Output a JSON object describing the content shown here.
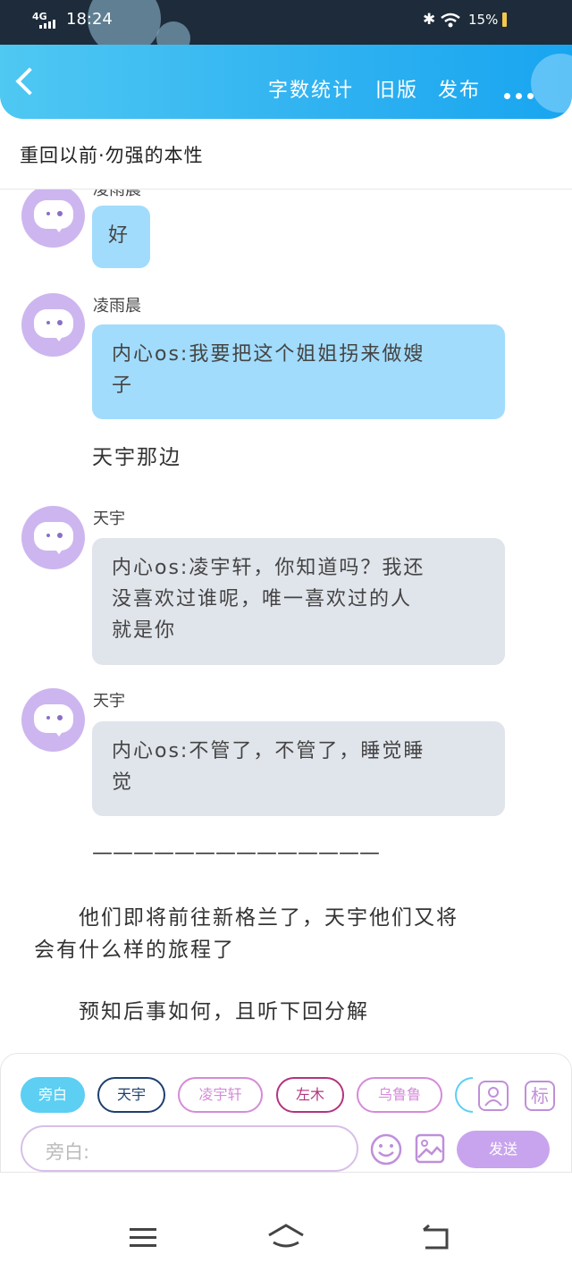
{
  "status_bar": {
    "network": "4G",
    "time": "18:24",
    "battery": "15%"
  },
  "header": {
    "buttons": [
      "字数统计",
      "旧版",
      "发布"
    ],
    "back_icon": "chevron-left-icon",
    "more_icon": "more-dots-icon"
  },
  "chapter_title": "重回以前·勿强的本性",
  "messages": [
    {
      "type": "bubble",
      "sender": "凌雨晨",
      "style": "blue",
      "lines": [
        "好"
      ]
    },
    {
      "type": "bubble",
      "sender": "凌雨晨",
      "style": "blue",
      "lines": [
        "内心os:我要把这个姐姐拐来做嫂",
        "子"
      ]
    },
    {
      "type": "narration",
      "lines": [
        "天宇那边"
      ]
    },
    {
      "type": "bubble",
      "sender": "天宇",
      "style": "gray",
      "lines": [
        "内心os:凌宇轩，你知道吗？我还",
        "没喜欢过谁呢，唯一喜欢过的人",
        "就是你"
      ]
    },
    {
      "type": "bubble",
      "sender": "天宇",
      "style": "gray",
      "lines": [
        "内心os:不管了，不管了，睡觉睡",
        "觉"
      ]
    },
    {
      "type": "narration",
      "lines": [
        "——————————————"
      ]
    },
    {
      "type": "narration",
      "lines": [
        "　　他们即将前往新格兰了，天宇他们又将",
        "会有什么样的旅程了"
      ]
    },
    {
      "type": "narration",
      "lines": [
        "　　预知后事如何，且听下回分解"
      ]
    }
  ],
  "composer": {
    "roles": [
      "旁白",
      "天宇",
      "凌宇轩",
      "左木",
      "乌鲁鲁"
    ],
    "input_placeholder": "旁白:",
    "send_label": "发送",
    "tag_label": "标",
    "colors": {
      "active": "#5ccff3",
      "purple": "#c8a4ee",
      "navy": "#1d3f6e",
      "pink": "#d58bd8",
      "magenta": "#b3337f"
    }
  }
}
